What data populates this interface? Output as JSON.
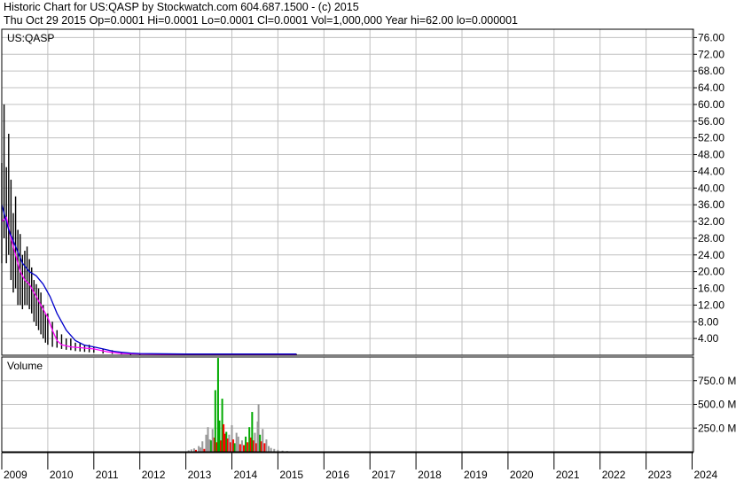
{
  "header": {
    "line1": "Historic Chart for US:QASP by Stockwatch.com 604.687.1500 - (c) 2015",
    "line2": "Thu Oct 29 2015   Op=0.0001   Hi=0.0001   Lo=0.0001   Cl=0.0001   Vol=1,000,000   Year hi=62.00   lo=0.000001"
  },
  "chart_data": {
    "type": "line",
    "symbol_label": "US:QASP",
    "price_axis": {
      "ticks": [
        "76.00",
        "72.00",
        "68.00",
        "64.00",
        "60.00",
        "56.00",
        "52.00",
        "48.00",
        "44.00",
        "40.00",
        "36.00",
        "32.00",
        "28.00",
        "24.00",
        "20.00",
        "16.00",
        "12.00",
        "8.00",
        "4.00"
      ],
      "ylim": [
        0,
        78
      ]
    },
    "volume_label": "Volume",
    "volume_axis": {
      "ticks": [
        "750.0 M",
        "500.0 M",
        "250.0 M"
      ],
      "ylim": [
        0,
        1000
      ]
    },
    "x_axis": {
      "years": [
        "2009",
        "2010",
        "2011",
        "2012",
        "2013",
        "2014",
        "2015",
        "2016",
        "2017",
        "2018",
        "2019",
        "2020",
        "2021",
        "2022",
        "2023",
        "2024"
      ]
    },
    "series": [
      {
        "color": "#000000",
        "style": "high-low bars",
        "x": [
          2009.0,
          2009.05,
          2009.1,
          2009.15,
          2009.2,
          2009.25,
          2009.3,
          2009.35,
          2009.4,
          2009.45,
          2009.5,
          2009.55,
          2009.6,
          2009.65,
          2009.7,
          2009.75,
          2009.8,
          2009.85,
          2009.9,
          2009.95,
          2010.0,
          2010.1,
          2010.2,
          2010.3,
          2010.4,
          2010.5,
          2010.6,
          2010.7,
          2010.8,
          2010.9,
          2011.0,
          2011.2,
          2011.4,
          2011.6,
          2011.8,
          2012.0,
          2012.5,
          2013.0,
          2013.5,
          2014.0,
          2014.5,
          2015.0,
          2015.4
        ],
        "high": [
          46,
          60,
          45,
          53,
          42,
          34,
          38,
          30,
          29,
          24,
          25,
          26,
          23,
          21,
          18,
          17,
          16,
          15,
          12,
          10,
          10,
          8,
          6,
          5,
          4,
          4,
          3,
          3,
          2.5,
          2.5,
          2,
          1.5,
          1.2,
          0.8,
          0.6,
          0.5,
          0.3,
          0.3,
          0.3,
          0.3,
          0.3,
          0.3,
          0.3
        ],
        "low": [
          22,
          28,
          22,
          24,
          18,
          15,
          16,
          12,
          12,
          11,
          12,
          12,
          11,
          10,
          8,
          7,
          6,
          5,
          4,
          3,
          2.5,
          2,
          1.8,
          1.5,
          1.3,
          1.2,
          1,
          0.9,
          0.8,
          0.7,
          0.6,
          0.4,
          0.3,
          0.2,
          0.1,
          0.1,
          0.05,
          0.01,
          0.01,
          0.01,
          0.01,
          0.0001,
          0.0001
        ]
      },
      {
        "color": "#ff00ff",
        "style": "moving average",
        "x": [
          2009.0,
          2009.1,
          2009.2,
          2009.3,
          2009.4,
          2009.5,
          2009.6,
          2009.7,
          2009.8,
          2009.9,
          2010.0,
          2010.1,
          2010.2,
          2010.3,
          2010.5,
          2010.7,
          2011.0,
          2011.3,
          2011.6,
          2012.0,
          2013.0,
          2014.0,
          2015.0,
          2015.4
        ],
        "values": [
          32,
          33,
          28,
          24,
          20,
          18,
          17,
          15,
          13,
          11,
          9,
          6,
          3.5,
          2.5,
          2.0,
          1.8,
          1.5,
          0.8,
          0.4,
          0.3,
          0.2,
          0.2,
          0.2,
          0.2
        ]
      },
      {
        "color": "#0000cc",
        "style": "moving average",
        "x": [
          2009.0,
          2009.15,
          2009.3,
          2009.45,
          2009.6,
          2009.75,
          2009.9,
          2010.05,
          2010.2,
          2010.4,
          2010.6,
          2010.8,
          2011.0,
          2011.2,
          2011.4,
          2011.6,
          2011.8,
          2012.0,
          2013.0,
          2014.0,
          2015.0,
          2015.4
        ],
        "values": [
          36,
          30,
          26,
          22,
          20,
          19,
          17,
          14,
          10,
          6,
          3.5,
          2.4,
          2.0,
          1.5,
          1.0,
          0.7,
          0.5,
          0.4,
          0.3,
          0.3,
          0.3,
          0.3
        ]
      }
    ],
    "volume_bars": [
      {
        "x": 2013.06,
        "v": 15,
        "color": "#999999"
      },
      {
        "x": 2013.12,
        "v": 25,
        "color": "#999999"
      },
      {
        "x": 2013.18,
        "v": 35,
        "color": "#999999"
      },
      {
        "x": 2013.22,
        "v": 20,
        "color": "#ff0000"
      },
      {
        "x": 2013.28,
        "v": 60,
        "color": "#999999"
      },
      {
        "x": 2013.32,
        "v": 45,
        "color": "#999999"
      },
      {
        "x": 2013.36,
        "v": 110,
        "color": "#999999"
      },
      {
        "x": 2013.4,
        "v": 30,
        "color": "#ff0000"
      },
      {
        "x": 2013.44,
        "v": 180,
        "color": "#999999"
      },
      {
        "x": 2013.48,
        "v": 260,
        "color": "#999999"
      },
      {
        "x": 2013.52,
        "v": 130,
        "color": "#999999"
      },
      {
        "x": 2013.55,
        "v": 120,
        "color": "#00aa00"
      },
      {
        "x": 2013.58,
        "v": 240,
        "color": "#999999"
      },
      {
        "x": 2013.62,
        "v": 150,
        "color": "#ff0000"
      },
      {
        "x": 2013.64,
        "v": 650,
        "color": "#00aa00"
      },
      {
        "x": 2013.67,
        "v": 100,
        "color": "#ff0000"
      },
      {
        "x": 2013.7,
        "v": 990,
        "color": "#00aa00"
      },
      {
        "x": 2013.73,
        "v": 330,
        "color": "#00aa00"
      },
      {
        "x": 2013.76,
        "v": 120,
        "color": "#ff0000"
      },
      {
        "x": 2013.79,
        "v": 560,
        "color": "#00aa00"
      },
      {
        "x": 2013.82,
        "v": 290,
        "color": "#ff0000"
      },
      {
        "x": 2013.85,
        "v": 190,
        "color": "#ff0000"
      },
      {
        "x": 2013.88,
        "v": 210,
        "color": "#00aa00"
      },
      {
        "x": 2013.91,
        "v": 140,
        "color": "#ff0000"
      },
      {
        "x": 2013.94,
        "v": 180,
        "color": "#999999"
      },
      {
        "x": 2013.97,
        "v": 100,
        "color": "#ff0000"
      },
      {
        "x": 2014.0,
        "v": 280,
        "color": "#999999"
      },
      {
        "x": 2014.03,
        "v": 130,
        "color": "#ff0000"
      },
      {
        "x": 2014.06,
        "v": 90,
        "color": "#00aa00"
      },
      {
        "x": 2014.1,
        "v": 200,
        "color": "#999999"
      },
      {
        "x": 2014.14,
        "v": 160,
        "color": "#999999"
      },
      {
        "x": 2014.18,
        "v": 80,
        "color": "#ff0000"
      },
      {
        "x": 2014.22,
        "v": 120,
        "color": "#999999"
      },
      {
        "x": 2014.26,
        "v": 70,
        "color": "#ff0000"
      },
      {
        "x": 2014.3,
        "v": 160,
        "color": "#00aa00"
      },
      {
        "x": 2014.34,
        "v": 100,
        "color": "#ff0000"
      },
      {
        "x": 2014.38,
        "v": 260,
        "color": "#00aa00"
      },
      {
        "x": 2014.41,
        "v": 150,
        "color": "#ff0000"
      },
      {
        "x": 2014.44,
        "v": 420,
        "color": "#00aa00"
      },
      {
        "x": 2014.47,
        "v": 120,
        "color": "#ff0000"
      },
      {
        "x": 2014.5,
        "v": 200,
        "color": "#999999"
      },
      {
        "x": 2014.53,
        "v": 90,
        "color": "#ff0000"
      },
      {
        "x": 2014.56,
        "v": 320,
        "color": "#999999"
      },
      {
        "x": 2014.58,
        "v": 500,
        "color": "#999999"
      },
      {
        "x": 2014.61,
        "v": 180,
        "color": "#00aa00"
      },
      {
        "x": 2014.64,
        "v": 110,
        "color": "#ff0000"
      },
      {
        "x": 2014.67,
        "v": 240,
        "color": "#999999"
      },
      {
        "x": 2014.71,
        "v": 90,
        "color": "#ff0000"
      },
      {
        "x": 2014.75,
        "v": 130,
        "color": "#999999"
      },
      {
        "x": 2014.8,
        "v": 60,
        "color": "#999999"
      },
      {
        "x": 2014.85,
        "v": 40,
        "color": "#999999"
      },
      {
        "x": 2014.92,
        "v": 30,
        "color": "#999999"
      },
      {
        "x": 2015.0,
        "v": 20,
        "color": "#999999"
      },
      {
        "x": 2015.1,
        "v": 12,
        "color": "#999999"
      },
      {
        "x": 2015.2,
        "v": 8,
        "color": "#999999"
      },
      {
        "x": 2015.3,
        "v": 5,
        "color": "#999999"
      }
    ]
  },
  "colors": {
    "grid": "#c0c0c0",
    "axis": "#000000",
    "background": "#ffffff"
  }
}
